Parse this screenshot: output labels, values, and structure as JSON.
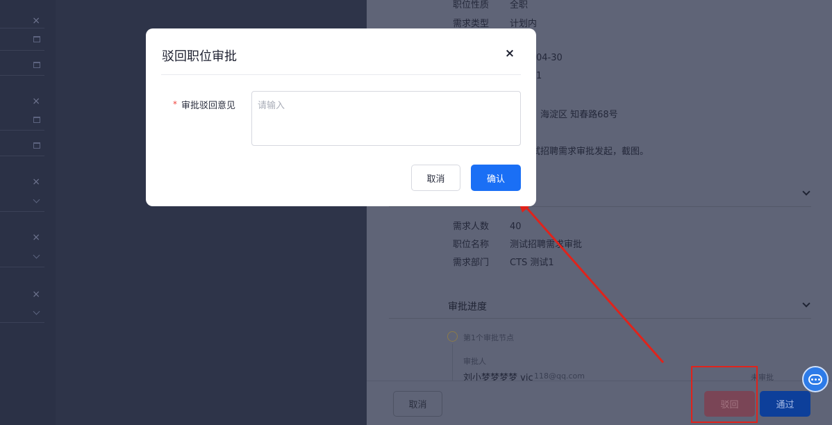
{
  "modal": {
    "title": "驳回职位审批",
    "close_symbol": "×",
    "required_mark": "*",
    "field_label": "审批驳回意见",
    "placeholder": "请输入",
    "cancel_label": "取消",
    "confirm_label": "确认"
  },
  "drawer": {
    "basic": [
      {
        "key": "职位性质",
        "value": "全职"
      },
      {
        "key": "需求类型",
        "value": "计划内"
      }
    ],
    "partial_date": "04-30",
    "partial_one": "1",
    "partial_address": "海淀区 知春路68号",
    "partial_note": "试招聘需求审批发起，截图。",
    "demand": [
      {
        "key": "需求人数",
        "value": "40"
      },
      {
        "key": "职位名称",
        "value": "测试招聘需求审批"
      },
      {
        "key": "需求部门",
        "value": "CTS 测试1"
      }
    ],
    "progress_title": "审批进度",
    "node_label": "第1个审批节点",
    "approver_label": "审批人",
    "approver_name": "刘小梦梦梦梦 vic",
    "approver_email": "118@qq.com",
    "approver_status": "未审批"
  },
  "footer": {
    "cancel_label": "取消",
    "reject_label": "驳回",
    "pass_label": "通过"
  },
  "colors": {
    "primary": "#1a6ff5",
    "annotation": "#e0231b"
  }
}
